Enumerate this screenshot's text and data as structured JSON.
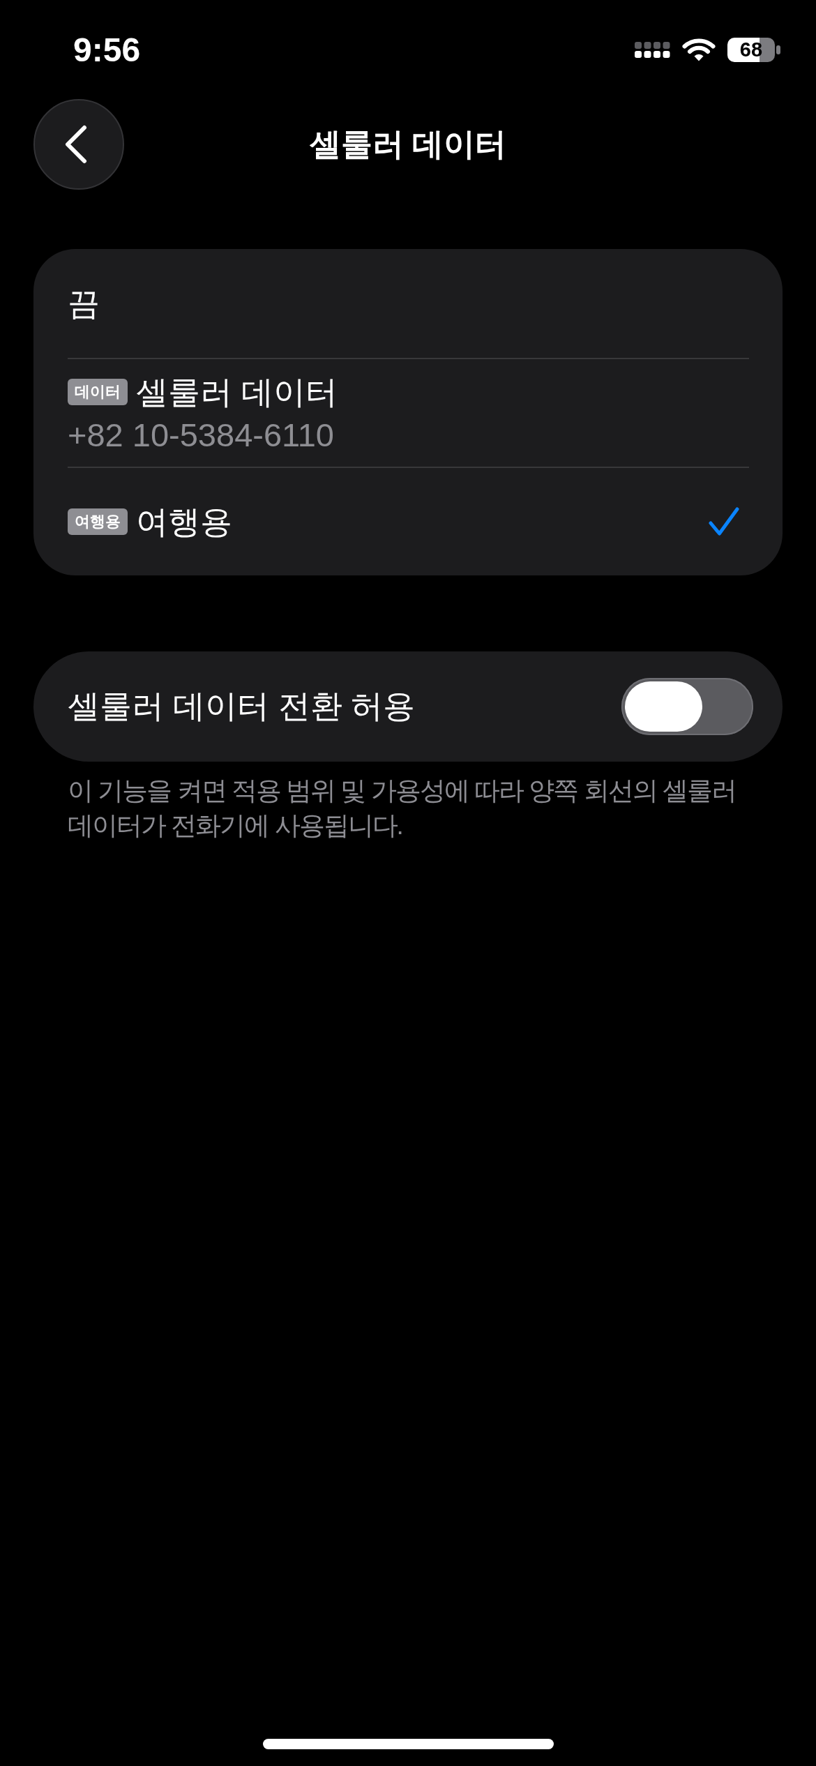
{
  "status_bar": {
    "time": "9:56",
    "battery": "68"
  },
  "header": {
    "title": "셀룰러 데이터"
  },
  "lines": [
    {
      "label": "끔",
      "selected": false
    },
    {
      "badge": "데이터",
      "label": "셀룰러 데이터",
      "number": "+82 10-5384-6110",
      "selected": false
    },
    {
      "badge": "여행용",
      "label": "여행용",
      "selected": true
    }
  ],
  "switch_row": {
    "label": "셀룰러 데이터 전환 허용",
    "on": false
  },
  "footer": "이 기능을 켜면 적용 범위 및 가용성에 따라 양쪽 회선의 셀룰러 데이터가 전화기에 사용됩니다."
}
